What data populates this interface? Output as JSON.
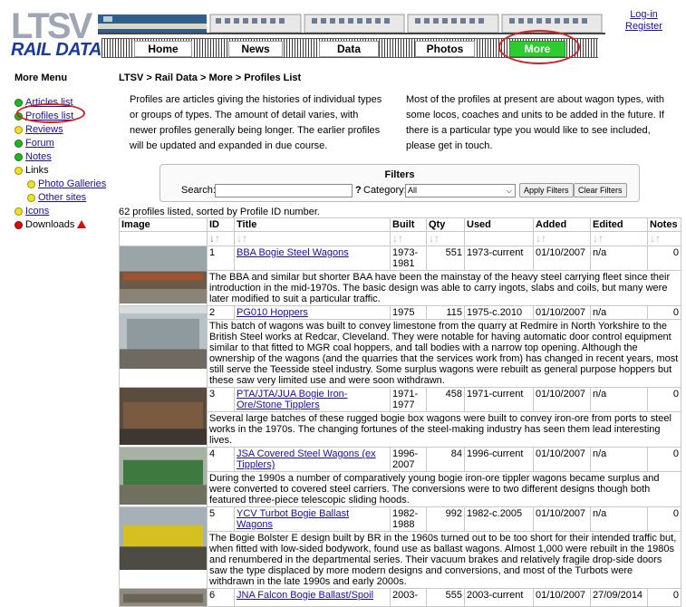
{
  "site": {
    "logo_text": "RAIL DATA",
    "logo_letters": "LTSV"
  },
  "nav": {
    "items": [
      {
        "label": "Home"
      },
      {
        "label": "News"
      },
      {
        "label": "Data"
      },
      {
        "label": "Photos"
      },
      {
        "label": "More"
      }
    ],
    "active": "More"
  },
  "auth": {
    "login": "Log-in",
    "register": "Register"
  },
  "sidebar": {
    "title": "More Menu",
    "items": [
      {
        "label": "Articles list",
        "dot": "green",
        "link": true
      },
      {
        "label": "Profiles list",
        "dot": "green",
        "link": true
      },
      {
        "label": "Reviews",
        "dot": "yellow",
        "link": true
      },
      {
        "label": "Forum",
        "dot": "green",
        "link": true
      },
      {
        "label": "Notes",
        "dot": "green",
        "link": true
      },
      {
        "label": "Links",
        "dot": "yellow",
        "link": false
      },
      {
        "label": "Photo Galleries",
        "dot": "yellow",
        "link": true,
        "sub": true
      },
      {
        "label": "Other sites",
        "dot": "yellow",
        "link": true,
        "sub": true
      },
      {
        "label": "Icons",
        "dot": "yellow",
        "link": true
      },
      {
        "label": "Downloads",
        "dot": "red",
        "link": false,
        "icon": "warning-icon"
      }
    ]
  },
  "breadcrumb": "LTSV > Rail Data > More > Profiles List",
  "intro": {
    "left": "Profiles are articles giving the histories of individual types or groups of types. The amount of detail varies, with newer profiles generally being longer. The earlier profiles will be updated and expanded in due course.",
    "right": "Most of the profiles at present are about wagon types, with some locos, coaches and units to be added in the future. If there is a particular type you would like to see included, please get in touch."
  },
  "filters": {
    "title": "Filters",
    "search_label": "Search:",
    "search_value": "",
    "help": "?",
    "category_label": "Category:",
    "category_value": "All",
    "apply": "Apply Filters",
    "clear": "Clear Filters"
  },
  "count_line": "62 profiles listed, sorted by Profile ID number.",
  "table": {
    "headers": [
      "Image",
      "ID",
      "Title",
      "Built",
      "Qty",
      "Used",
      "Added",
      "Edited",
      "Notes"
    ],
    "rows": [
      {
        "id": "1",
        "title": "BBA Bogie Steel Wagons",
        "built": "1973-1981",
        "qty": "551",
        "used": "1973-current",
        "added": "01/10/2007",
        "edited": "n/a",
        "notes": "0",
        "desc": "The BBA and similar but shorter BAA have been the mainstay of the heavy steel carrying fleet since their introduction in the mid-1970s. The basic design was able to carry ingots, slabs and coils, but many were later modified to suit a particular traffic."
      },
      {
        "id": "2",
        "title": "PG010 Hoppers",
        "built": "1975",
        "qty": "115",
        "used": "1975-c.2010",
        "added": "01/10/2007",
        "edited": "n/a",
        "notes": "0",
        "desc": "This batch of wagons was built to convey limestone from the quarry at Redmire in North Yorkshire to the British Steel works at Redcar, Cleveland. They were notable for having automatic door control equipment similar to that fitted to MGR coal hoppers, and tall bodies with a narrow top opening. Although the ownership of the wagons (and the quarries that the services work from) has changed in recent years, most still serve the Teesside steel industry. Some surplus wagons were rebuilt as general purpose hoppers but these saw very limited use and were soon withdrawn."
      },
      {
        "id": "3",
        "title": "PTA/JTA/JUA Bogie Iron-Ore/Stone Tipplers",
        "built": "1971-1977",
        "qty": "458",
        "used": "1971-current",
        "added": "01/10/2007",
        "edited": "n/a",
        "notes": "0",
        "desc": "Several large batches of these rugged bogie box wagons were built to convey iron-ore from ports to steel works in the 1970s. The changing fortunes of the steel-making industry has seen them lead interesting lives."
      },
      {
        "id": "4",
        "title": "JSA Covered Steel Wagons (ex Tipplers)",
        "built": "1996-2007",
        "qty": "84",
        "used": "1996-current",
        "added": "01/10/2007",
        "edited": "n/a",
        "notes": "0",
        "desc": "During the 1990s a number of comparatively young bogie iron-ore tippler wagons became surplus and were converted to covered steel carriers. The conversions were to two different designs though both featured three-piece telescopic sliding hoods."
      },
      {
        "id": "5",
        "title": "YCV Turbot Bogie Ballast Wagons",
        "built": "1982-1988",
        "qty": "992",
        "used": "1982-c.2005",
        "added": "01/10/2007",
        "edited": "n/a",
        "notes": "0",
        "desc": "The Bogie Bolster E design built by BR in the 1960s turned out to be too short for their intended traffic but, when fitted with low-sided bodywork, found use as ballast wagons. Almost 1,000 were rebuilt in the 1980s and renumbered in the departmental series. Their vacuum brakes and relatively fragile drop-side doors saw the type displaced by more modern designs and conversions, and most of the Turbots were withdrawn in the late 1990s and early 2000s."
      },
      {
        "id": "6",
        "title": "JNA Falcon Bogie Ballast/Spoil",
        "built": "2003-",
        "qty": "555",
        "used": "2003-current",
        "added": "01/10/2007",
        "edited": "27/09/2014",
        "notes": "0",
        "desc": ""
      }
    ]
  },
  "colors": {
    "nav_active": "#2ecc2e",
    "highlight_circle": "#d42020",
    "logo_blue": "#1a3a9e",
    "link": "#1a0dab"
  }
}
